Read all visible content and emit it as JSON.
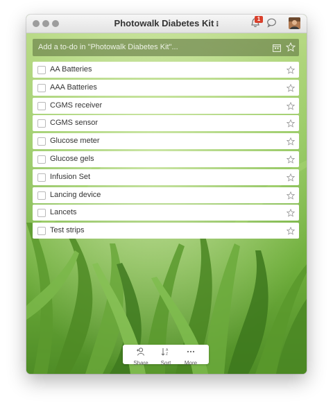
{
  "window": {
    "title": "Photowalk Diabetes Kit",
    "title_menu_glyph": "⁝"
  },
  "titlebar_icons": {
    "notifications": {
      "icon": "bell-icon",
      "badge": "1"
    },
    "conversations": {
      "icon": "speech-bubble-icon"
    },
    "avatar": {
      "icon": "user-avatar"
    }
  },
  "add_todo": {
    "placeholder": "Add a to-do in \"Photowalk Diabetes Kit\"...",
    "calendar_icon": "calendar-icon",
    "star_icon": "star-icon"
  },
  "todos": [
    {
      "label": "AA Batteries",
      "checked": false,
      "starred": false
    },
    {
      "label": "AAA Batteries",
      "checked": false,
      "starred": false
    },
    {
      "label": "CGMS receiver",
      "checked": false,
      "starred": false
    },
    {
      "label": "CGMS sensor",
      "checked": false,
      "starred": false
    },
    {
      "label": "Glucose meter",
      "checked": false,
      "starred": false
    },
    {
      "label": "Glucose gels",
      "checked": false,
      "starred": false
    },
    {
      "label": "Infusion Set",
      "checked": false,
      "starred": false
    },
    {
      "label": "Lancing device",
      "checked": false,
      "starred": false
    },
    {
      "label": "Lancets",
      "checked": false,
      "starred": false
    },
    {
      "label": "Test strips",
      "checked": false,
      "starred": false
    }
  ],
  "toolbar": {
    "share_label": "Share",
    "sort_label": "Sort",
    "more_label": "More"
  },
  "colors": {
    "grass_light": "#c9e59a",
    "grass_mid": "#7cb84a",
    "grass_dark": "#3f7a1f",
    "badge_red": "#d9402c"
  }
}
